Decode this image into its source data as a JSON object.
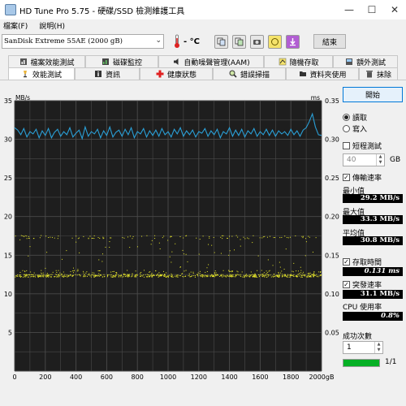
{
  "window": {
    "title": "HD Tune Pro 5.75 - 硬碟/SSD 檢測維護工具"
  },
  "menu": [
    {
      "label": "檔案(F)"
    },
    {
      "label": "說明(H)"
    }
  ],
  "toolbar": {
    "drive": "SanDisk Extreme 55AE (2000 gB)",
    "temperature": "- °C",
    "exit_label": "結束",
    "icons": [
      "copy-icon",
      "copy-screenshot-icon",
      "camera-icon",
      "health-link-icon",
      "save-download-icon"
    ]
  },
  "tabs_top": [
    {
      "label": "檔案效能測試",
      "icon": "file-benchmark-icon"
    },
    {
      "label": "磁碟監控",
      "icon": "disk-monitor-icon"
    },
    {
      "label": "自動噪聲管理(AAM)",
      "icon": "speaker-icon"
    },
    {
      "label": "隨機存取",
      "icon": "random-access-icon"
    },
    {
      "label": "額外測試",
      "icon": "extra-tests-icon"
    }
  ],
  "tabs_bottom": [
    {
      "label": "效能測試",
      "icon": "benchmark-icon"
    },
    {
      "label": "資訊",
      "icon": "info-icon"
    },
    {
      "label": "健康狀態",
      "icon": "health-cross-icon"
    },
    {
      "label": "錯誤掃描",
      "icon": "magnifier-icon"
    },
    {
      "label": "資料夾使用",
      "icon": "folder-icon"
    },
    {
      "label": "抹除",
      "icon": "trash-icon"
    }
  ],
  "side": {
    "start_label": "開始",
    "read_label": "讀取",
    "write_label": "寫入",
    "short_test_label": "短程測試",
    "short_test_value": "40",
    "gb_label": "GB",
    "transfer_rate_label": "傳輸速率",
    "min_label": "最小值",
    "min_value": "29.2 MB/s",
    "max_label": "最大值",
    "max_value": "33.3 MB/s",
    "avg_label": "平均值",
    "avg_value": "30.8 MB/s",
    "access_time_label": "存取時間",
    "access_time_value": "0.131 ms",
    "burst_rate_label": "突發速率",
    "burst_rate_value": "31.1 MB/s",
    "cpu_label": "CPU 使用率",
    "cpu_value": "0.8%",
    "pass_label": "成功次數",
    "pass_value": "1",
    "progress_text": "1/1",
    "progress": 1.0
  },
  "chart_data": {
    "type": "line",
    "y_left_unit": "MB/s",
    "y_right_unit": "ms",
    "y_left_ticks": [
      "35",
      "30",
      "25",
      "20",
      "15",
      "10",
      "5"
    ],
    "y_right_ticks": [
      "0.35",
      "0.30",
      "0.25",
      "0.20",
      "0.15",
      "0.10",
      "0.05"
    ],
    "x_ticks": [
      "0",
      "200",
      "400",
      "600",
      "800",
      "1000",
      "1200",
      "1400",
      "1600",
      "1800",
      "2000gB"
    ],
    "xlim": [
      0,
      2000
    ],
    "ylim_left": [
      0,
      35
    ],
    "ylim_right": [
      0,
      0.35
    ],
    "grid": true,
    "colors": {
      "transfer": "#2a9fd6",
      "access": "#e8e82a",
      "background": "#1e1e1e",
      "grid": "#4a4a4a"
    },
    "transfer_rate": {
      "x": [
        0,
        20,
        40,
        60,
        80,
        100,
        120,
        140,
        160,
        180,
        200,
        220,
        240,
        260,
        280,
        300,
        320,
        340,
        360,
        380,
        400,
        420,
        440,
        460,
        480,
        500,
        520,
        540,
        560,
        580,
        600,
        620,
        640,
        660,
        680,
        700,
        720,
        740,
        760,
        780,
        800,
        820,
        840,
        860,
        880,
        900,
        920,
        940,
        960,
        980,
        1000,
        1020,
        1040,
        1060,
        1080,
        1100,
        1120,
        1140,
        1160,
        1180,
        1200,
        1220,
        1240,
        1260,
        1280,
        1300,
        1320,
        1340,
        1360,
        1380,
        1400,
        1420,
        1440,
        1460,
        1480,
        1500,
        1520,
        1540,
        1560,
        1580,
        1600,
        1620,
        1640,
        1660,
        1680,
        1700,
        1720,
        1740,
        1760,
        1780,
        1800,
        1820,
        1840,
        1860,
        1880,
        1900,
        1920,
        1940,
        1960,
        1980,
        2000
      ],
      "y": [
        31.5,
        31.2,
        30.6,
        31.4,
        30.3,
        31.0,
        30.7,
        31.3,
        30.2,
        31.1,
        30.5,
        31.4,
        30.2,
        30.9,
        31.3,
        30.4,
        31.0,
        30.6,
        31.5,
        30.3,
        30.8,
        31.2,
        30.1,
        31.6,
        30.4,
        31.0,
        30.7,
        31.3,
        30.2,
        31.1,
        30.5,
        31.6,
        30.3,
        30.9,
        31.2,
        30.4,
        31.3,
        30.6,
        31.5,
        30.2,
        31.0,
        30.7,
        31.4,
        30.3,
        31.1,
        30.5,
        31.2,
        30.4,
        31.4,
        30.6,
        31.0,
        30.3,
        31.3,
        30.7,
        31.5,
        30.4,
        31.1,
        30.6,
        31.2,
        30.3,
        31.0,
        30.8,
        31.4,
        30.4,
        31.1,
        30.6,
        31.3,
        30.2,
        31.0,
        30.7,
        31.5,
        30.4,
        31.2,
        30.5,
        31.3,
        30.3,
        31.1,
        30.7,
        31.4,
        30.4,
        31.0,
        30.6,
        31.3,
        30.5,
        31.2,
        30.4,
        31.1,
        30.7,
        31.0,
        30.5,
        31.3,
        30.6,
        31.1,
        30.4,
        31.2,
        31.5,
        32.3,
        33.3,
        31.6,
        30.6,
        30.5
      ]
    },
    "access_time": {
      "dense_band_ms": [
        0.122,
        0.131
      ],
      "upper_band_ms": [
        0.172,
        0.176
      ],
      "x_range": [
        0,
        2000
      ]
    }
  }
}
